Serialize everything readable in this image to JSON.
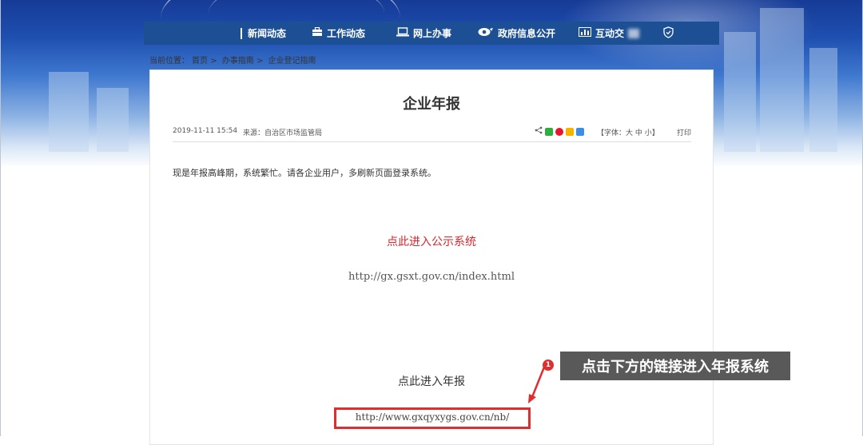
{
  "nav": {
    "items": [
      {
        "label": "新闻动态",
        "icon": "news-icon"
      },
      {
        "label": "工作动态",
        "icon": "briefcase-icon"
      },
      {
        "label": "网上办事",
        "icon": "laptop-icon"
      },
      {
        "label": "政府信息公开",
        "icon": "eye-icon"
      },
      {
        "label": "互动交",
        "icon": "bar-chart-icon"
      }
    ],
    "extra_icon": "shield-icon"
  },
  "breadcrumb": {
    "prefix": "当前位置：",
    "items": [
      "首页",
      "办事指南",
      "企业登记指南"
    ],
    "separator": ">"
  },
  "article": {
    "title": "企业年报",
    "date": "2019-11-11 15:54",
    "source": "来源：自治区市场监管局",
    "share_icons": [
      "share-icon",
      "wechat-icon",
      "weibo-icon",
      "qzone-icon",
      "qq-icon"
    ],
    "font_size_prefix": "【字体：",
    "font_sizes": [
      "大",
      "中",
      "小"
    ],
    "font_size_suffix": "】",
    "print_label": "打印",
    "notice": "现是年报高峰期，系统繁忙。请各企业用户，多刷新页面登录系统。",
    "link1_text": "点此进入公示系统",
    "link1_url": "http://gx.gsxt.gov.cn/index.html",
    "link2_text": "点此进入年报",
    "link2_url": "http://www.gxqyxygs.gov.cn/nb/"
  },
  "callout": {
    "number": "1",
    "text": "点击下方的链接进入年报系统"
  },
  "colors": {
    "nav_bg": "#1c4f93",
    "link_red": "#d9262b",
    "highlight_red": "#e02d2d",
    "callout_bg": "#595959"
  }
}
